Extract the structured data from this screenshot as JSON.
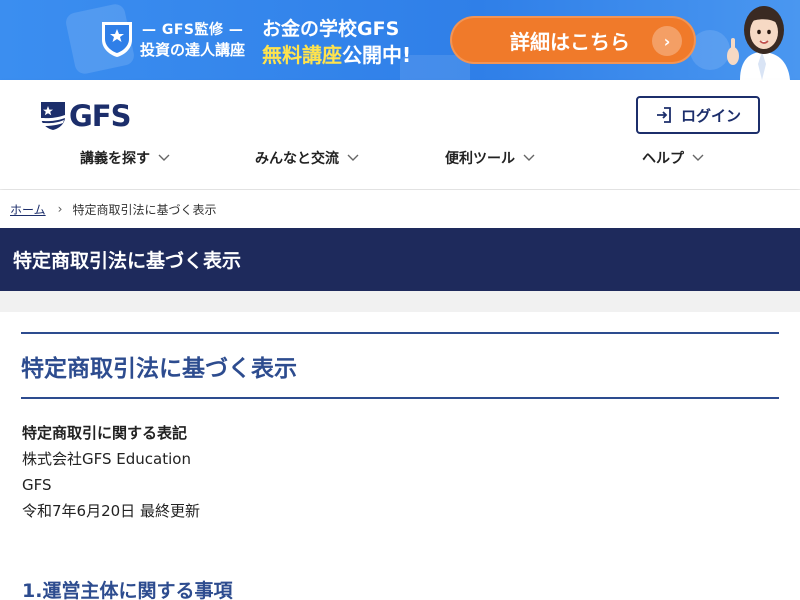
{
  "banner": {
    "supervision": "— GFS監修 —",
    "course_name": "投資の達人講座",
    "headline_line1": "お金の学校GFS",
    "headline_highlight": "無料講座",
    "headline_rest": "公開中!",
    "cta_label": "詳細はこちら",
    "cta_arrow": "›",
    "accent_color": "#f07a2a",
    "background_color": "#3b8ef0"
  },
  "header": {
    "logo_text": "GFS",
    "login_label": "ログイン",
    "brand_color": "#1c2e6b"
  },
  "nav": {
    "items": [
      {
        "label": "講義を探す"
      },
      {
        "label": "みんなと交流"
      },
      {
        "label": "便利ツール"
      },
      {
        "label": "ヘルプ"
      }
    ]
  },
  "breadcrumb": {
    "home": "ホーム",
    "separator": "›",
    "current": "特定商取引法に基づく表示"
  },
  "page": {
    "title_bar": "特定商取引法に基づく表示",
    "heading": "特定商取引法に基づく表示",
    "info_title": "特定商取引に関する表記",
    "company": "株式会社GFS Education",
    "brand": "GFS",
    "updated": "令和7年6月20日 最終更新",
    "section1_title": "1.運営主体に関する事項"
  }
}
